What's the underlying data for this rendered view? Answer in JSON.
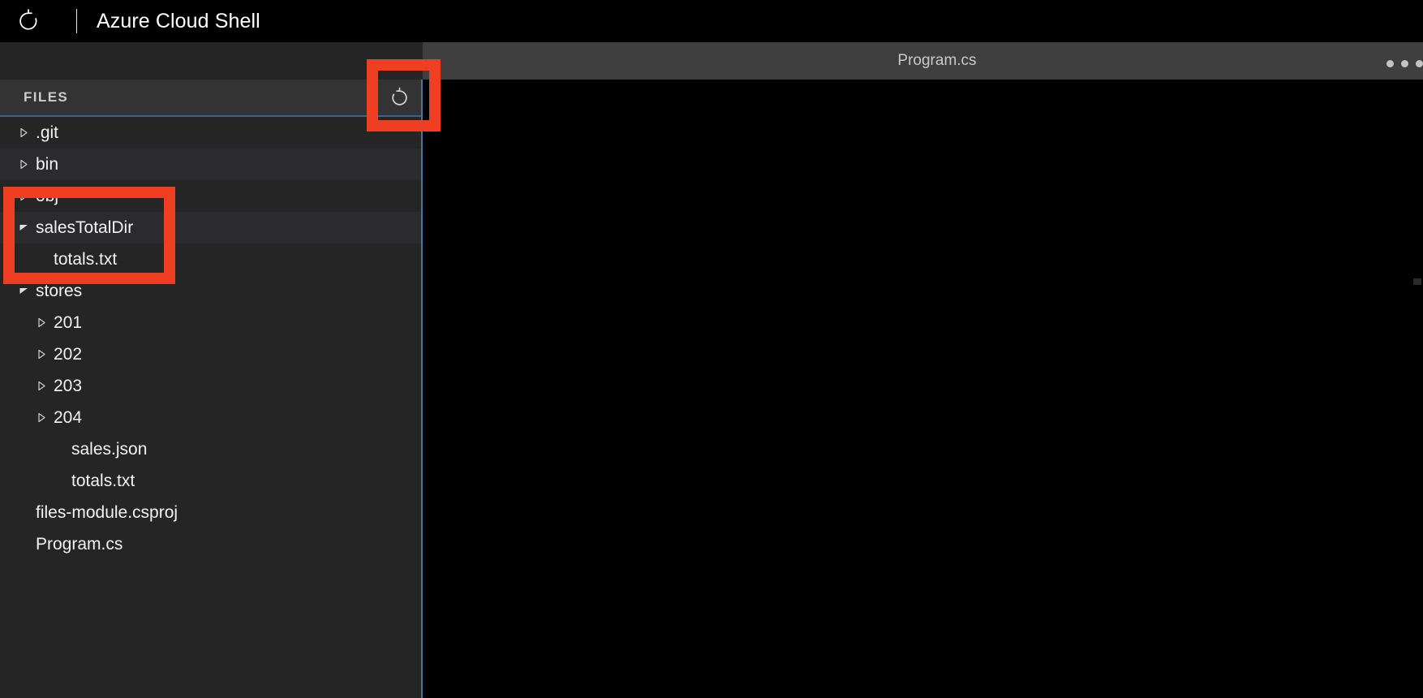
{
  "topbar": {
    "restart_icon": "restart-icon",
    "title": "Azure Cloud Shell"
  },
  "sidebar": {
    "header_title": "FILES",
    "refresh_icon": "refresh-icon",
    "tree": [
      {
        "label": ".git",
        "indent": 0,
        "twisty": "collapsed",
        "band": false
      },
      {
        "label": "bin",
        "indent": 0,
        "twisty": "collapsed",
        "band": true
      },
      {
        "label": "obj",
        "indent": 0,
        "twisty": "collapsed",
        "band": false
      },
      {
        "label": "salesTotalDir",
        "indent": 0,
        "twisty": "expanded",
        "band": true
      },
      {
        "label": "totals.txt",
        "indent": 1,
        "twisty": "none",
        "band": false
      },
      {
        "label": "stores",
        "indent": 0,
        "twisty": "expanded",
        "band": false
      },
      {
        "label": "201",
        "indent": 1,
        "twisty": "collapsed",
        "band": false
      },
      {
        "label": "202",
        "indent": 1,
        "twisty": "collapsed",
        "band": false
      },
      {
        "label": "203",
        "indent": 1,
        "twisty": "collapsed",
        "band": false
      },
      {
        "label": "204",
        "indent": 1,
        "twisty": "collapsed",
        "band": false
      },
      {
        "label": "sales.json",
        "indent": 2,
        "twisty": "none",
        "band": false
      },
      {
        "label": "totals.txt",
        "indent": 2,
        "twisty": "none",
        "band": false
      },
      {
        "label": "files-module.csproj",
        "indent": 0,
        "twisty": "none",
        "band": false
      },
      {
        "label": "Program.cs",
        "indent": 0,
        "twisty": "none",
        "band": false
      }
    ]
  },
  "editor": {
    "tab_label": "Program.cs",
    "more_icon": "more-options-icon"
  },
  "annotations": [
    {
      "name": "refresh-button-highlight",
      "target": "refresh-icon"
    },
    {
      "name": "salestotaldir-highlight",
      "target": "salesTotalDir"
    }
  ],
  "colors": {
    "annotation_red": "#ee3f23",
    "accent_blue": "#4a74a0",
    "panel_bg": "#252526",
    "header_bg": "#333333",
    "strip_bg": "#3f3f3f",
    "editor_bg": "#000000"
  }
}
